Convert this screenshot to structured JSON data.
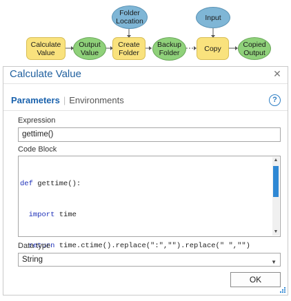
{
  "model": {
    "nodes": {
      "calculate_value": "Calculate\nValue",
      "output_value": "Output\nValue",
      "create_folder": "Create\nFolder",
      "folder_location": "Folder\nLocation",
      "backup_folder": "Backup\nFolder",
      "input": "Input",
      "copy": "Copy",
      "copied_output": "Copied\nOutput"
    },
    "colors": {
      "tool": "#f9e27d",
      "output": "#8fd17a",
      "input": "#7fb6d6"
    }
  },
  "dialog": {
    "title": "Calculate Value",
    "tabs": {
      "parameters": "Parameters",
      "separator": "|",
      "environments": "Environments"
    },
    "help_icon": "?",
    "expression": {
      "label": "Expression",
      "value": "gettime()"
    },
    "code_block": {
      "label": "Code Block",
      "lines": [
        [
          "def",
          " gettime():"
        ],
        [
          "  import",
          " time"
        ],
        [
          "  return",
          " time.ctime().replace(\":\",\"\").replace(\" \",\"\")"
        ]
      ]
    },
    "data_type": {
      "label": "Data type",
      "value": "String"
    },
    "ok_label": "OK",
    "accent_color": "#1a62ad"
  }
}
